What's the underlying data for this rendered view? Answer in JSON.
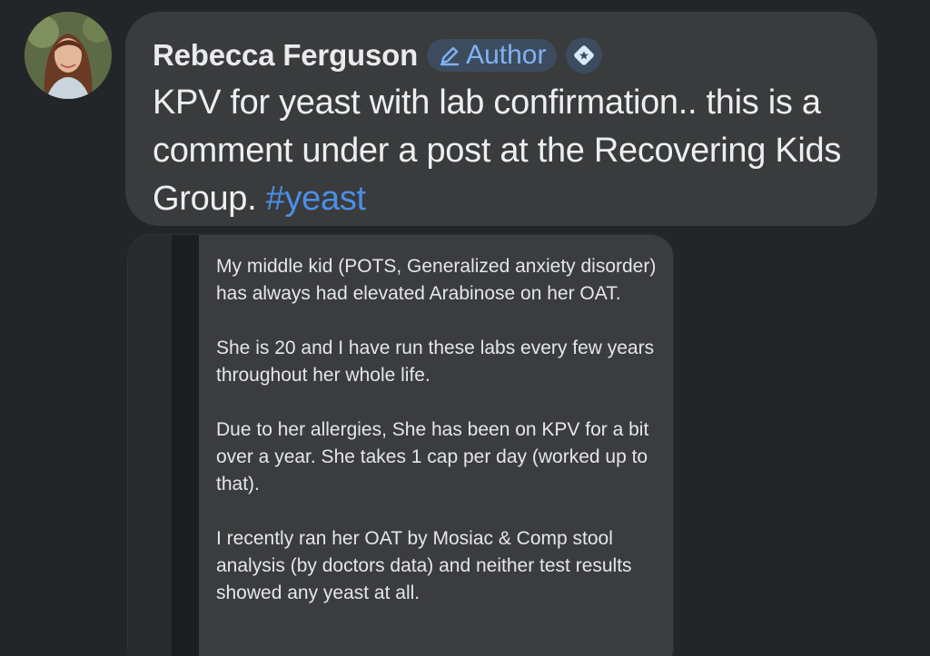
{
  "post": {
    "author": {
      "name": "Rebecca Ferguson",
      "badge_label": "Author"
    },
    "comment_text": "KPV for yeast with lab confirmation.. this is a comment under a post at the Recovering Kids Group. ",
    "hashtag": "#yeast"
  },
  "shared_quote": {
    "paragraphs": [
      "My middle kid (POTS, Generalized anxiety disorder) has always had elevated Arabinose on her OAT.",
      "She is 20 and I have run these labs every few years throughout her whole life.",
      "Due to her allergies, She has been on KPV for a bit over a year. She takes 1 cap per day (worked up to that).",
      "I recently ran her OAT by Mosiac & Comp stool analysis (by doctors data) and neither test results showed any yeast at all."
    ]
  },
  "colors": {
    "background": "#232628",
    "bubble": "#3a3b3c",
    "hashtag": "#4a8fe8",
    "badge_text": "#7fb2f3"
  },
  "icons": {
    "author_badge": "pencil-icon",
    "second_badge": "diamond-star-icon"
  }
}
